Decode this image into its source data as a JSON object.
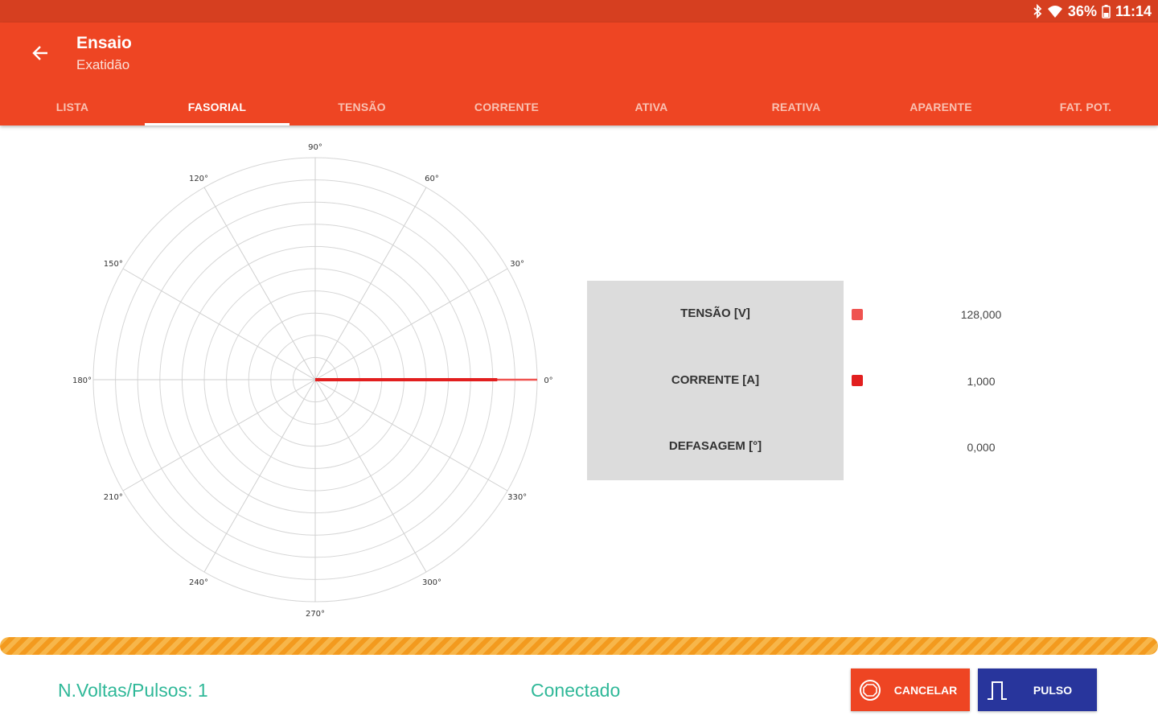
{
  "status_bar": {
    "battery": "36%",
    "time": "11:14",
    "icons": [
      "bluetooth-icon",
      "wifi-icon",
      "battery-icon"
    ]
  },
  "app_bar": {
    "title": "Ensaio",
    "subtitle": "Exatidão",
    "back_icon": "arrow-back-icon"
  },
  "tabs": [
    {
      "label": "LISTA",
      "active": false
    },
    {
      "label": "FASORIAL",
      "active": true
    },
    {
      "label": "TENSÃO",
      "active": false
    },
    {
      "label": "CORRENTE",
      "active": false
    },
    {
      "label": "ATIVA",
      "active": false
    },
    {
      "label": "REATIVA",
      "active": false
    },
    {
      "label": "APARENTE",
      "active": false
    },
    {
      "label": "FAT. POT.",
      "active": false
    }
  ],
  "chart_data": {
    "type": "polar",
    "angle_labels": [
      "0°",
      "30°",
      "60°",
      "90°",
      "120°",
      "150°",
      "180°",
      "210°",
      "240°",
      "270°",
      "300°",
      "330°"
    ],
    "rings": 10,
    "grid": true,
    "series": [
      {
        "name": "TENSÃO [V]",
        "color": "#ef5350",
        "angle": 0,
        "magnitude": 1.0
      },
      {
        "name": "CORRENTE [A]",
        "color": "#e21f1f",
        "angle": 0,
        "magnitude": 0.82
      }
    ]
  },
  "readings": [
    {
      "label": "TENSÃO [V]",
      "value": "128,000",
      "color": "#ef5350"
    },
    {
      "label": "CORRENTE [A]",
      "value": "1,000",
      "color": "#e21f1f"
    },
    {
      "label": "DEFASAGEM [°]",
      "value": "0,000",
      "color": ""
    }
  ],
  "footer": {
    "pulses_text": "N.Voltas/Pulsos: 1",
    "status_text": "Conectado"
  },
  "buttons": {
    "cancel_label": "CANCELAR",
    "cancel_icon": "stop-icon",
    "pulse_label": "PULSO",
    "pulse_icon": "pulse-icon"
  },
  "colors": {
    "primary": "#ee4523",
    "primary_dark": "#d63f20",
    "accent": "#28359c",
    "footer_text": "#2fb898"
  }
}
